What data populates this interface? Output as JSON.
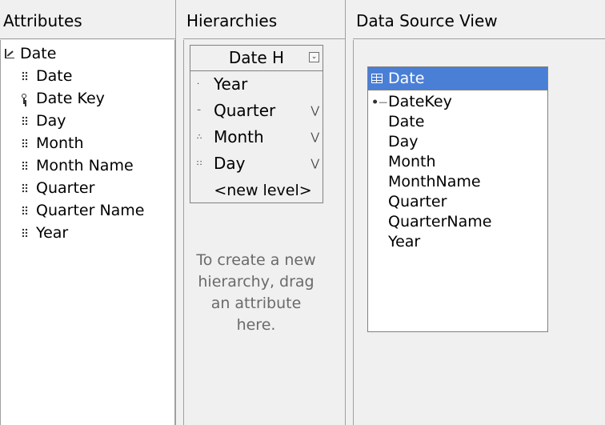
{
  "attributes": {
    "header": "Attributes",
    "root_label": "Date",
    "items": [
      {
        "label": "Date",
        "icon": "attribute-icon"
      },
      {
        "label": "Date Key",
        "icon": "key-attribute-icon"
      },
      {
        "label": "Day",
        "icon": "attribute-icon"
      },
      {
        "label": "Month",
        "icon": "attribute-icon"
      },
      {
        "label": "Month Name",
        "icon": "attribute-icon"
      },
      {
        "label": "Quarter",
        "icon": "attribute-icon"
      },
      {
        "label": "Quarter Name",
        "icon": "attribute-icon"
      },
      {
        "label": "Year",
        "icon": "attribute-icon"
      }
    ]
  },
  "hierarchies": {
    "header": "Hierarchies",
    "hierarchy": {
      "name": "Date H",
      "levels": [
        {
          "label": "Year",
          "icon": "level-1-icon",
          "has_chevron": false
        },
        {
          "label": "Quarter",
          "icon": "level-2-icon",
          "has_chevron": true
        },
        {
          "label": "Month",
          "icon": "level-3-icon",
          "has_chevron": true
        },
        {
          "label": "Day",
          "icon": "level-4-icon",
          "has_chevron": true
        }
      ],
      "new_level_label": "<new level>"
    },
    "hint": "To create a new hierarchy, drag an attribute here."
  },
  "dsv": {
    "header": "Data Source View",
    "table": {
      "name": "Date",
      "columns": [
        {
          "label": "DateKey",
          "is_key": true
        },
        {
          "label": "Date",
          "is_key": false
        },
        {
          "label": "Day",
          "is_key": false
        },
        {
          "label": "Month",
          "is_key": false
        },
        {
          "label": "MonthName",
          "is_key": false
        },
        {
          "label": "Quarter",
          "is_key": false
        },
        {
          "label": "QuarterName",
          "is_key": false
        },
        {
          "label": "Year",
          "is_key": false
        }
      ]
    }
  },
  "colors": {
    "selection": "#4a7fd6",
    "pane_background": "#f0f0f0",
    "hint_text": "#6a6a6a"
  }
}
